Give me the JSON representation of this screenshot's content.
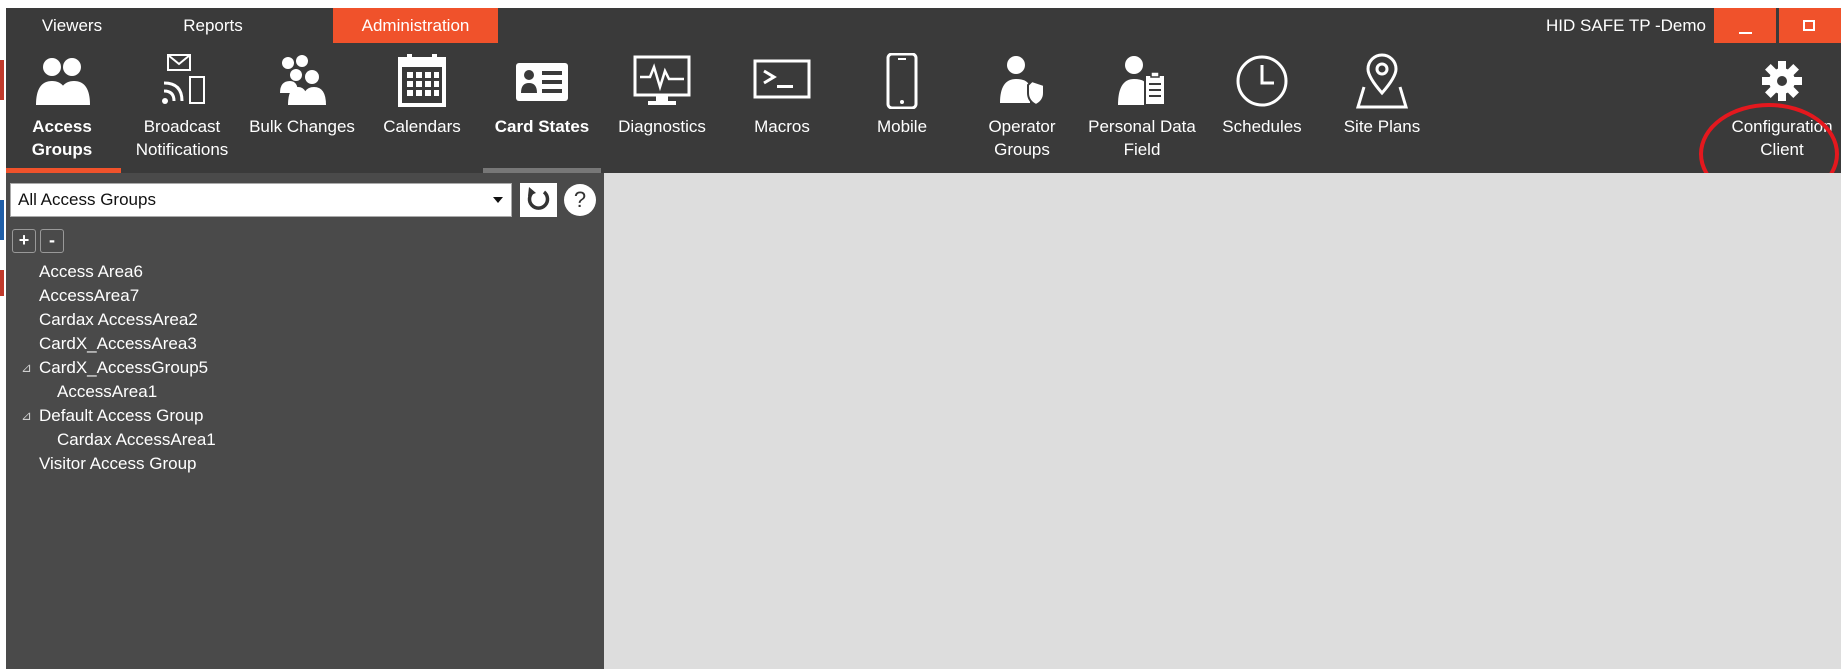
{
  "top_tabs": [
    {
      "label": "Viewers"
    },
    {
      "label": "Reports"
    },
    {
      "label": "Administration"
    }
  ],
  "window": {
    "title": "HID SAFE TP -Demo"
  },
  "ribbon": [
    {
      "label": "Access Groups",
      "icon": "people-icon"
    },
    {
      "label": "Broadcast Notifications",
      "icon": "broadcast-icon"
    },
    {
      "label": "Bulk Changes",
      "icon": "group-icon"
    },
    {
      "label": "Calendars",
      "icon": "calendar-icon"
    },
    {
      "label": "Card States",
      "icon": "id-card-icon"
    },
    {
      "label": "Diagnostics",
      "icon": "monitor-pulse-icon"
    },
    {
      "label": "Macros",
      "icon": "terminal-icon"
    },
    {
      "label": "Mobile",
      "icon": "mobile-icon"
    },
    {
      "label": "Operator Groups",
      "icon": "operator-shield-icon"
    },
    {
      "label": "Personal Data Field",
      "icon": "person-clipboard-icon"
    },
    {
      "label": "Schedules",
      "icon": "clock-icon"
    },
    {
      "label": "Site Plans",
      "icon": "map-pin-icon"
    },
    {
      "label": "Configuration Client",
      "icon": "gear-icon"
    }
  ],
  "panel": {
    "dropdown_value": "All Access Groups",
    "help_label": "?",
    "add_label": "+",
    "remove_label": "-"
  },
  "tree": [
    {
      "label": "Access Area6"
    },
    {
      "label": "AccessArea7"
    },
    {
      "label": "Cardax AccessArea2"
    },
    {
      "label": "CardX_AccessArea3"
    },
    {
      "label": "CardX_AccessGroup5",
      "toggle": "⊿"
    },
    {
      "label": "AccessArea1"
    },
    {
      "label": "Default Access Group",
      "toggle": "⊿"
    },
    {
      "label": "Cardax AccessArea1"
    },
    {
      "label": "Visitor Access Group"
    }
  ],
  "colors": {
    "accent": "#f0522b",
    "ribbon_bg": "#3a3a3a",
    "panel_bg": "#4a4a4a",
    "content_bg": "#dddddd",
    "highlight": "#e4181e"
  }
}
